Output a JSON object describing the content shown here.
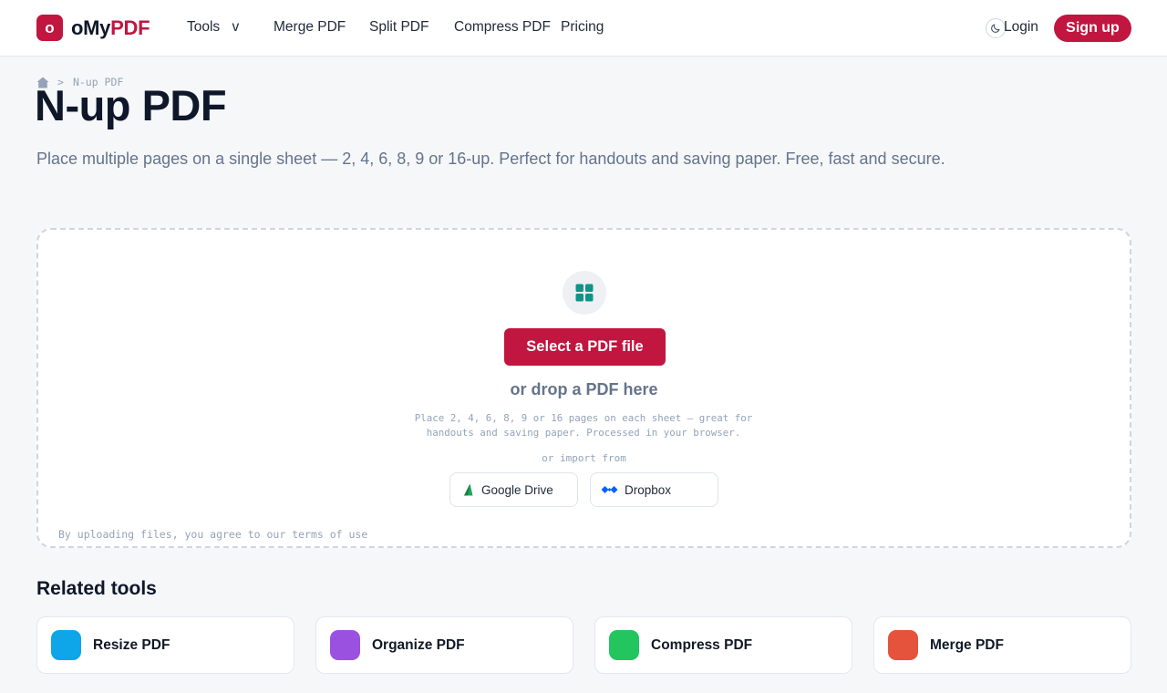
{
  "brand": {
    "badge": "o",
    "name_part1": "oMy",
    "name_part2": "PDF",
    "color": "#c0163f"
  },
  "nav": {
    "tools": "Tools",
    "tools_caret": "v",
    "merge": "Merge PDF",
    "split": "Split PDF",
    "compress": "Compress PDF",
    "pricing": "Pricing",
    "theme_icon": "moon-icon",
    "login": "Login",
    "signup": "Sign up"
  },
  "breadcrumb": {
    "home_icon": "home-icon",
    "separator": ">",
    "current": "N-up PDF"
  },
  "page": {
    "title": "N-up PDF",
    "subtitle": "Place multiple pages on a single sheet — 2, 4, 6, 8, 9 or 16-up. Perfect for handouts and saving paper. Free, fast and secure."
  },
  "dropzone": {
    "icon": "grid-icon",
    "select_button": "Select a PDF file",
    "drop_text": "or drop a PDF here",
    "description": "Place 2, 4, 6, 8, 9 or 16 pages on each sheet — great for handouts and saving paper. Processed in your browser.",
    "import_label": "or import from",
    "google_drive": "Google Drive",
    "dropbox": "Dropbox",
    "terms": "By uploading files, you agree to our terms of use"
  },
  "related": {
    "title": "Related tools",
    "tools": [
      {
        "label": "Resize PDF",
        "color": "#0ea5e9"
      },
      {
        "label": "Organize PDF",
        "color": "#9b51e0"
      },
      {
        "label": "Compress PDF",
        "color": "#22c55e"
      },
      {
        "label": "Merge PDF",
        "color": "#e5533d"
      }
    ]
  }
}
